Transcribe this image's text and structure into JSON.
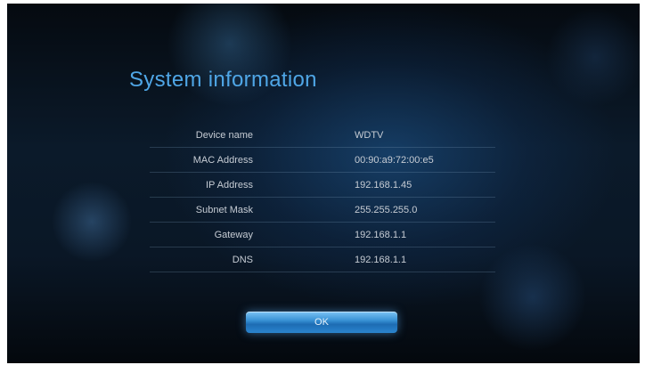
{
  "dialog": {
    "title": "System information",
    "rows": [
      {
        "label": "Device name",
        "value": "WDTV"
      },
      {
        "label": "MAC Address",
        "value": "00:90:a9:72:00:e5"
      },
      {
        "label": "IP Address",
        "value": "192.168.1.45"
      },
      {
        "label": "Subnet Mask",
        "value": "255.255.255.0"
      },
      {
        "label": "Gateway",
        "value": "192.168.1.1"
      },
      {
        "label": "DNS",
        "value": "192.168.1.1"
      }
    ],
    "ok_label": "OK"
  },
  "colors": {
    "title": "#4fa6e6",
    "text": "#c6ccd4",
    "button": "#3a93d6"
  }
}
